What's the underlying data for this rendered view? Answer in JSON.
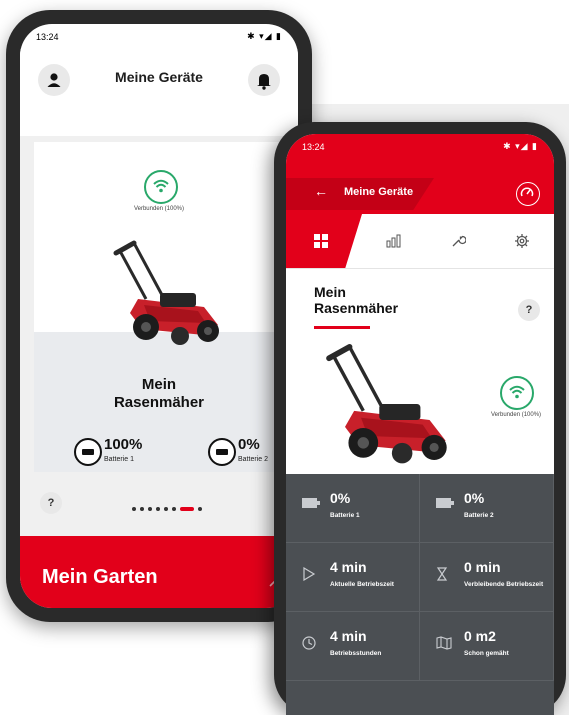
{
  "phone_back": {
    "status_time": "13:24",
    "status_icons": "✱ ▾◢ ▮",
    "header_title": "Meine Geräte",
    "connection_label": "Verbunden (100%)",
    "device_name_line1": "Mein",
    "device_name_line2": "Rasenmäher",
    "battery1_value": "100%",
    "battery1_label": "Batterie 1",
    "battery2_value": "0%",
    "battery2_label": "Batterie 2",
    "help_label": "?",
    "pager_active_index": 6,
    "footer_title": "Mein Garten"
  },
  "phone_front": {
    "status_time": "13:24",
    "status_icons": "✱ ▾◢ ▮",
    "back_arrow": "←",
    "header_title": "Meine Geräte",
    "device_name_line1": "Mein",
    "device_name_line2": "Rasenmäher",
    "help_label": "?",
    "connection_label": "Verbunden (100%)",
    "tabs": [
      {
        "name": "dashboard",
        "icon": "grid-icon",
        "active": true
      },
      {
        "name": "statistics",
        "icon": "bar-chart-icon",
        "active": false
      },
      {
        "name": "service",
        "icon": "wrench-icon",
        "active": false
      },
      {
        "name": "settings",
        "icon": "gear-icon",
        "active": false
      }
    ],
    "stats": [
      {
        "value": "0%",
        "label": "Batterie 1",
        "icon": "battery-icon"
      },
      {
        "value": "0%",
        "label": "Batterie 2",
        "icon": "battery-icon"
      },
      {
        "value": "4 min",
        "label": "Aktuelle Betriebszeit",
        "icon": "play-icon"
      },
      {
        "value": "0 min",
        "label": "Verbleibende Betriebszeit",
        "icon": "hourglass-icon"
      },
      {
        "value": "4 min",
        "label": "Betriebsstunden",
        "icon": "clock-icon"
      },
      {
        "value": "0 m2",
        "label": "Schon gemäht",
        "icon": "map-icon"
      }
    ]
  },
  "colors": {
    "brand_red": "#e2001a",
    "connected_green": "#29a86a",
    "tile_gray": "#4b4f53"
  }
}
